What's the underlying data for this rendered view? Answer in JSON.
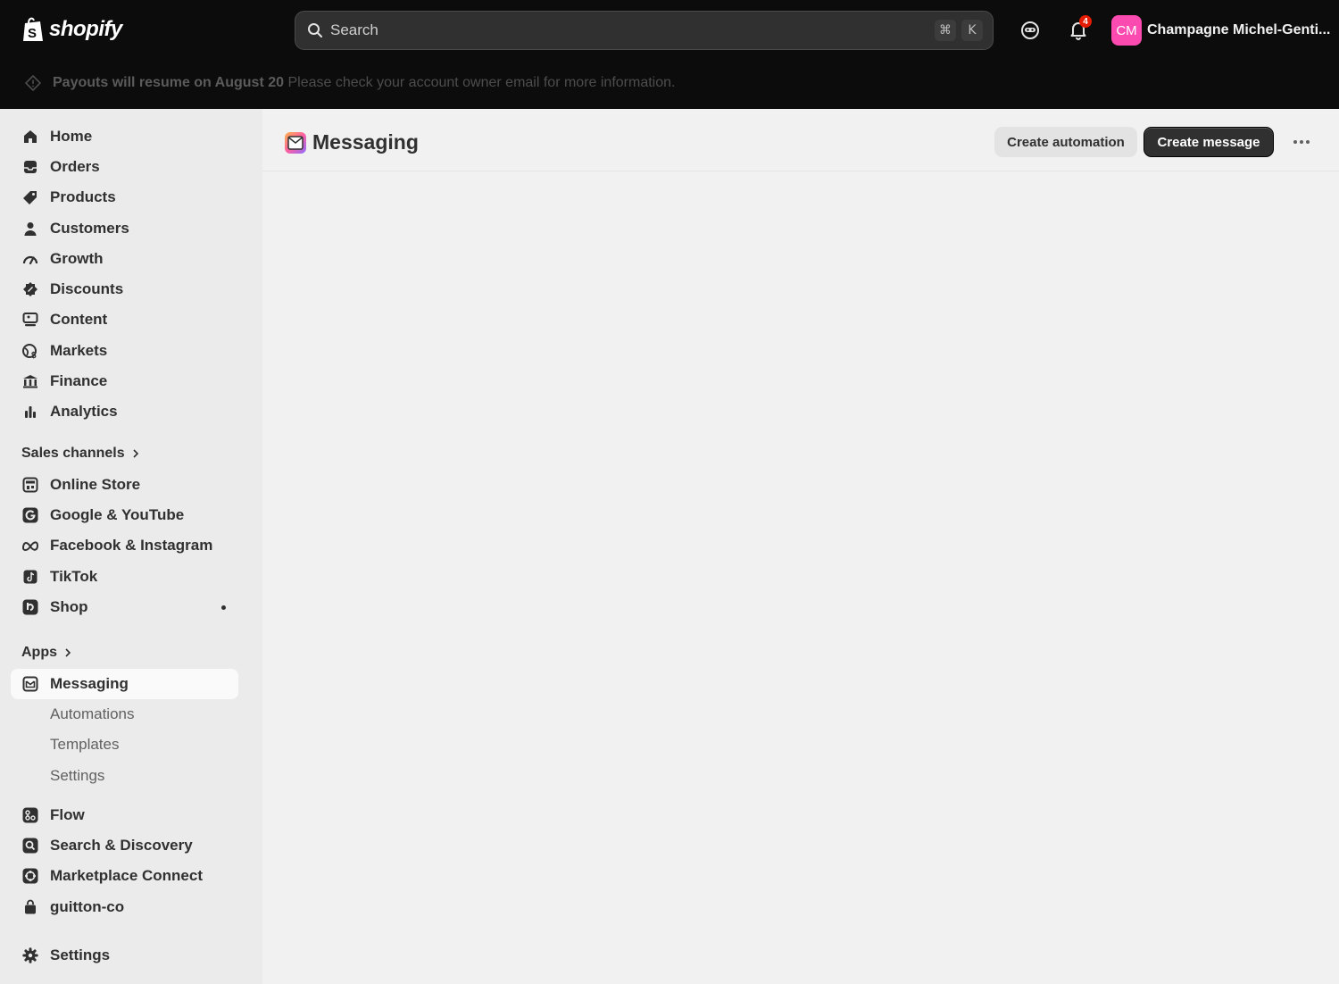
{
  "topbar": {
    "brand": "shopify",
    "search_placeholder": "Search",
    "shortcut_cmd": "⌘",
    "shortcut_key": "K",
    "notification_count": "4",
    "avatar_initials": "CM",
    "account_name": "Champagne Michel-Genti...",
    "banner_bold": "Payouts will resume on August 20",
    "banner_text": "Please check your account owner email for more information."
  },
  "sidebar": {
    "main_items": [
      {
        "label": "Home",
        "icon": "home-icon"
      },
      {
        "label": "Orders",
        "icon": "inbox-icon"
      },
      {
        "label": "Products",
        "icon": "tag-icon"
      },
      {
        "label": "Customers",
        "icon": "person-icon"
      },
      {
        "label": "Growth",
        "icon": "gauge-icon"
      },
      {
        "label": "Discounts",
        "icon": "discount-icon"
      },
      {
        "label": "Content",
        "icon": "content-icon"
      },
      {
        "label": "Markets",
        "icon": "globe-icon"
      },
      {
        "label": "Finance",
        "icon": "bank-icon"
      },
      {
        "label": "Analytics",
        "icon": "bar-chart-icon"
      }
    ],
    "sales_channels_label": "Sales channels",
    "sales_channels": [
      {
        "label": "Online Store",
        "icon": "store-icon"
      },
      {
        "label": "Google & YouTube",
        "icon": "google-icon"
      },
      {
        "label": "Facebook & Instagram",
        "icon": "meta-icon"
      },
      {
        "label": "TikTok",
        "icon": "tiktok-icon"
      },
      {
        "label": "Shop",
        "icon": "shop-icon"
      }
    ],
    "apps_label": "Apps",
    "apps": [
      {
        "label": "Messaging",
        "icon": "messaging-icon",
        "active": true
      }
    ],
    "messaging_sub": [
      "Automations",
      "Templates",
      "Settings"
    ],
    "more_apps": [
      {
        "label": "Flow",
        "icon": "flow-icon"
      },
      {
        "label": "Search & Discovery",
        "icon": "search-discovery-icon"
      },
      {
        "label": "Marketplace Connect",
        "icon": "marketplace-icon"
      },
      {
        "label": "guitton-co",
        "icon": "bag-icon"
      }
    ],
    "settings_label": "Settings"
  },
  "main": {
    "title": "Messaging",
    "create_automation": "Create automation",
    "create_message": "Create message"
  },
  "colors": {
    "topbar": "#0c0c0c",
    "sidebar": "#ebebeb",
    "main": "#f1f1f1",
    "avatar": "#fb4bb0",
    "primary_button": "#303030"
  }
}
